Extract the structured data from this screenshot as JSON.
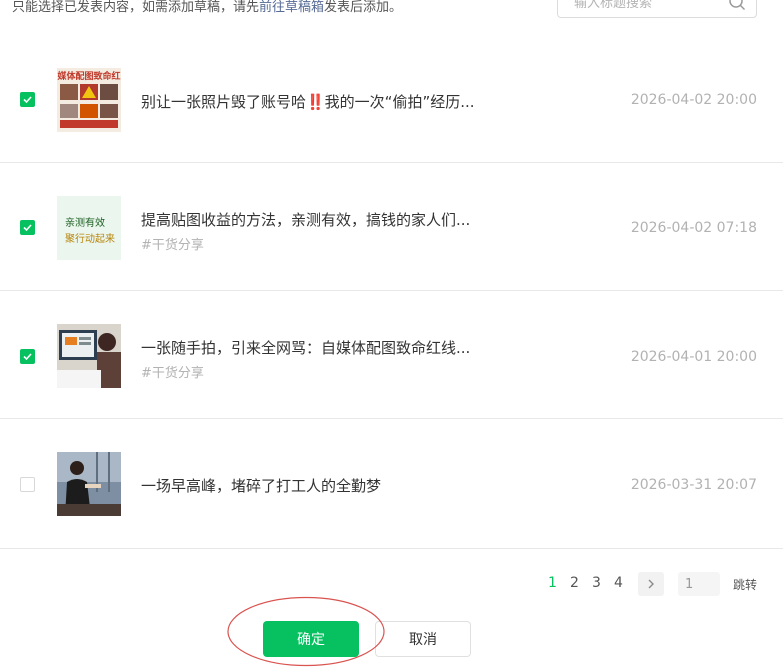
{
  "notice": {
    "prefix": "只能选择已发表内容，如需添加草稿，请先",
    "link": "前往草稿箱",
    "suffix": "发表后添加。"
  },
  "search": {
    "placeholder": "输入标题搜索"
  },
  "articles": [
    {
      "title": "别让一张照片毁了账号哈‼️我的一次“偷拍”经历...",
      "tag": "",
      "date": "2026-04-02 20:00",
      "checked": true,
      "thumb_text": "媒体配图致命红"
    },
    {
      "title": "提高贴图收益的方法，亲测有效，搞钱的家人们...",
      "tag": "#干货分享",
      "date": "2026-04-02 07:18",
      "checked": true,
      "thumb_text_1": "亲测有效",
      "thumb_text_2": "聚行动起来"
    },
    {
      "title": "一张随手拍，引来全网骂：自媒体配图致命红线...",
      "tag": "#干货分享",
      "date": "2026-04-01 20:00",
      "checked": true
    },
    {
      "title": "一场早高峰，堵碎了打工人的全勤梦",
      "tag": "",
      "date": "2026-03-31 20:07",
      "checked": false
    }
  ],
  "pagination": {
    "pages": [
      "1",
      "2",
      "3",
      "4"
    ],
    "current": "1",
    "jump_value": "1",
    "jump_label": "跳转"
  },
  "actions": {
    "confirm": "确定",
    "cancel": "取消"
  },
  "colors": {
    "accent": "#07c160",
    "link": "#576b95",
    "annotation": "#d9534f"
  }
}
